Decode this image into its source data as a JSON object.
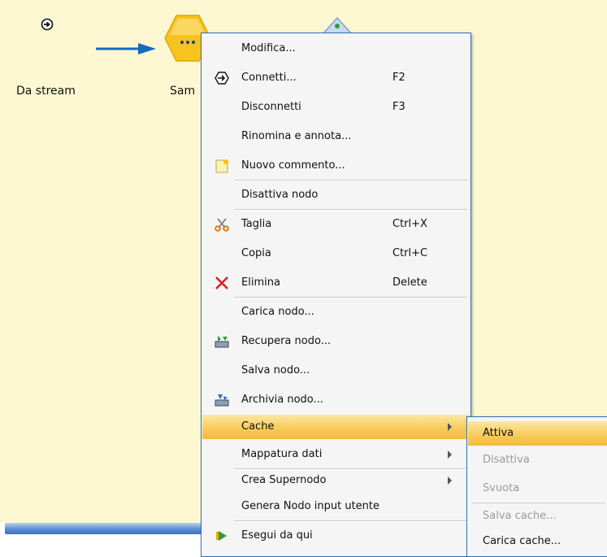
{
  "canvas": {
    "source_node_label": "Da stream",
    "sample_node_label": "Sam"
  },
  "context_menu": {
    "items": [
      {
        "label": "Modifica...",
        "shortcut": "",
        "icon": ""
      },
      {
        "label": "Connetti...",
        "shortcut": "F2",
        "icon": "connect-icon"
      },
      {
        "label": "Disconnetti",
        "shortcut": "F3",
        "icon": ""
      },
      {
        "label": "Rinomina e annota...",
        "shortcut": "",
        "icon": ""
      },
      {
        "label": "Nuovo commento...",
        "shortcut": "",
        "icon": "new-comment-icon"
      },
      {
        "label": "Disattiva nodo",
        "shortcut": "",
        "icon": ""
      },
      {
        "label": "Taglia",
        "shortcut": "Ctrl+X",
        "icon": "scissors-icon"
      },
      {
        "label": "Copia",
        "shortcut": "Ctrl+C",
        "icon": ""
      },
      {
        "label": "Elimina",
        "shortcut": "Delete",
        "icon": "delete-x-icon"
      },
      {
        "label": "Carica nodo...",
        "shortcut": "",
        "icon": ""
      },
      {
        "label": "Recupera nodo...",
        "shortcut": "",
        "icon": "retrieve-node-icon"
      },
      {
        "label": "Salva nodo...",
        "shortcut": "",
        "icon": ""
      },
      {
        "label": "Archivia nodo...",
        "shortcut": "",
        "icon": "archive-node-icon"
      },
      {
        "label": "Cache",
        "shortcut": "",
        "icon": "",
        "submenu": true,
        "highlighted": true
      },
      {
        "label": "Mappatura dati",
        "shortcut": "",
        "icon": "",
        "submenu": true
      },
      {
        "label": "Crea Supernodo",
        "shortcut": "",
        "icon": "",
        "submenu": true
      },
      {
        "label": "Genera Nodo input utente",
        "shortcut": "",
        "icon": ""
      },
      {
        "label": "Esegui da qui",
        "shortcut": "",
        "icon": "run-from-here-icon"
      }
    ]
  },
  "cache_submenu": {
    "items": [
      {
        "label": "Attiva",
        "enabled": true,
        "highlighted": true
      },
      {
        "label": "Disattiva",
        "enabled": false
      },
      {
        "label": "Svuota",
        "enabled": false
      },
      {
        "label": "Salva cache...",
        "enabled": false
      },
      {
        "label": "Carica cache...",
        "enabled": true
      }
    ]
  },
  "colors": {
    "canvas_background": "#fdf8d1",
    "menu_border": "#2b6fb8",
    "highlight": "#f7c957",
    "arrow": "#1a66c2"
  }
}
